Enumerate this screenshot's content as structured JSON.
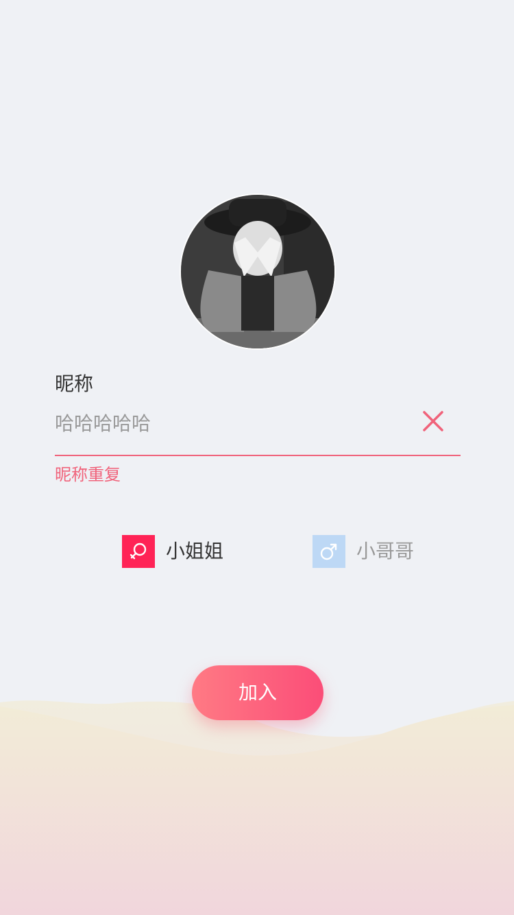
{
  "nickname": {
    "label": "昵称",
    "value": "哈哈哈哈哈",
    "error": "昵称重复"
  },
  "gender": {
    "female_label": "小姐姐",
    "male_label": "小哥哥",
    "selected": "female"
  },
  "join_label": "加入",
  "icons": {
    "clear": "close-icon",
    "female": "female-symbol-icon",
    "male": "male-symbol-icon"
  },
  "colors": {
    "accent": "#f0627a",
    "female": "#ff2356",
    "male": "#bdd8f5",
    "background": "#eff1f5"
  }
}
